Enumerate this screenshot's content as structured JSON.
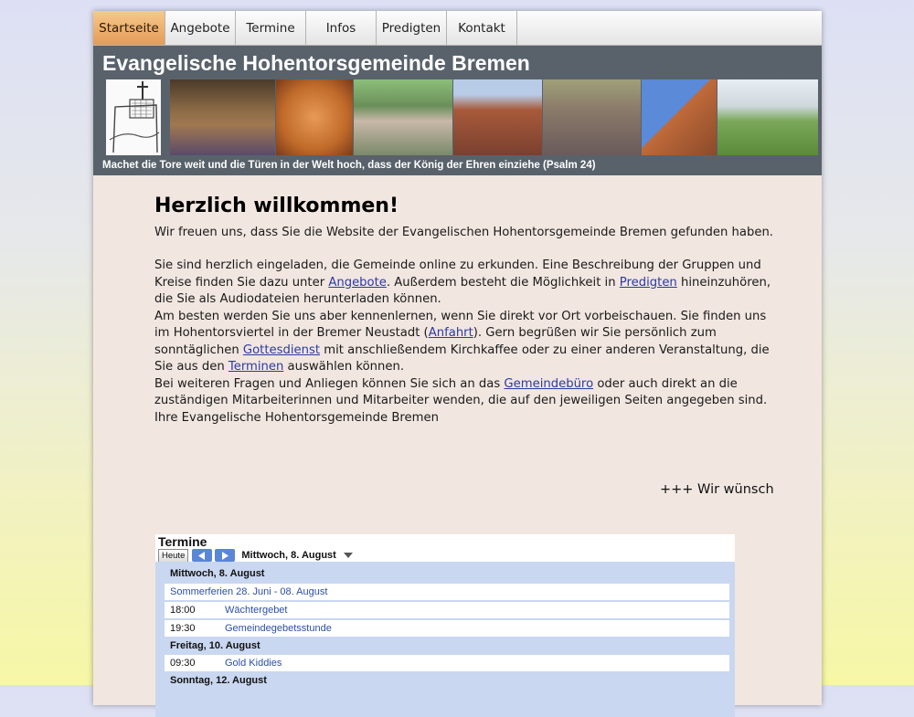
{
  "nav": {
    "items": [
      {
        "label": "Startseite",
        "active": true
      },
      {
        "label": "Angebote",
        "active": false
      },
      {
        "label": "Termine",
        "active": false
      },
      {
        "label": "Infos",
        "active": false
      },
      {
        "label": "Predigten",
        "active": false
      },
      {
        "label": "Kontakt",
        "active": false
      }
    ]
  },
  "header": {
    "title": "Evangelische Hohentorsgemeinde Bremen",
    "motto": "Machet die Tore weit und die Türen in der Welt hoch, dass der König der Ehren einziehe (Psalm 24)"
  },
  "main": {
    "heading": "Herzlich willkommen!",
    "intro": "Wir freuen uns, dass Sie die Website der Evangelischen Hohentorsgemeinde Bremen gefunden haben.",
    "p1_a": "Sie sind herzlich eingeladen, die Gemeinde online zu erkunden. Eine Beschreibung der Gruppen und Kreise finden Sie dazu unter ",
    "link_angebote": "Angebote",
    "p1_b": ". Außerdem besteht die Möglichkeit in ",
    "link_predigten": "Predigten",
    "p1_c": " hineinzuhören, die Sie als Audiodateien herunterladen können.",
    "p2_a": "Am besten werden Sie uns aber kennenlernen, wenn Sie direkt vor Ort vorbeischauen. Sie finden uns im Hohentorsviertel in der Bremer Neustadt (",
    "link_anfahrt": "Anfahrt",
    "p2_b": "). Gern begrüßen wir Sie persönlich zum sonntäglichen ",
    "link_gottesdienst": "Gottesdienst",
    "p2_c": " mit anschließendem Kirchkaffee oder zu einer anderen Veranstaltung, die Sie aus den ",
    "link_terminen": "Terminen",
    "p2_d": " auswählen können.",
    "p3_a": "Bei weiteren Fragen und Anliegen können Sie sich an das ",
    "link_gemeindebuero": "Gemeindebüro",
    "p3_b": " oder auch direkt an die zuständigen Mitarbeiterinnen und Mitarbeiter wenden, die auf den jeweiligen Seiten angegeben sind.",
    "closing": "Ihre Evangelische Hohentorsgemeinde Bremen",
    "ticker": "+++ Wir wünsch"
  },
  "calendar": {
    "title": "Termine",
    "today_label": "Heute",
    "current_date": "Mittwoch, 8. August",
    "entries": [
      {
        "kind": "day",
        "text": "Mittwoch, 8. August"
      },
      {
        "kind": "allday",
        "text": "Sommerferien 28. Juni - 08. August"
      },
      {
        "kind": "event",
        "time": "18:00",
        "title": "Wächtergebet"
      },
      {
        "kind": "event",
        "time": "19:30",
        "title": "Gemeindegebetsstunde"
      },
      {
        "kind": "day",
        "text": "Freitag, 10. August"
      },
      {
        "kind": "event",
        "time": "09:30",
        "title": "Gold Kiddies"
      },
      {
        "kind": "day",
        "text": "Sonntag, 12. August"
      }
    ]
  },
  "colors": {
    "accent_tab": "#e49c56",
    "banner_bg": "#59626b",
    "page_bg": "#f1e6e0",
    "link": "#2b3aa3",
    "calendar_accent": "#c9d7f0"
  },
  "icons": [
    "cross-drawing-icon",
    "prev-arrow-icon",
    "next-arrow-icon",
    "dropdown-caret-icon"
  ]
}
